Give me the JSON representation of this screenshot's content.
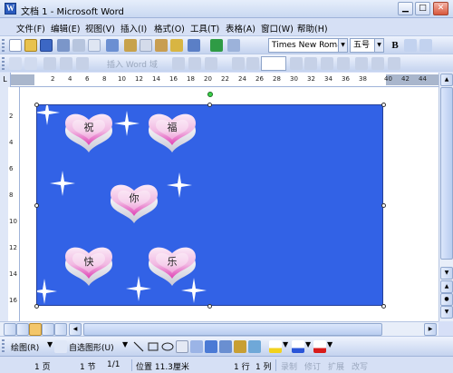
{
  "window": {
    "title": "文档 1 - Microsoft Word",
    "app_icon": "W",
    "min": "▁",
    "max": "□",
    "close": "✕"
  },
  "menu": [
    {
      "label": "文件(F)"
    },
    {
      "label": "编辑(E)"
    },
    {
      "label": "视图(V)"
    },
    {
      "label": "插入(I)"
    },
    {
      "label": "格式(O)"
    },
    {
      "label": "工具(T)"
    },
    {
      "label": "表格(A)"
    },
    {
      "label": "窗口(W)"
    },
    {
      "label": "帮助(H)"
    }
  ],
  "toolbar": {
    "font_name": "Times New Roman",
    "font_size": "五号",
    "bold": "B",
    "italic": "I"
  },
  "toolbar2": {
    "insert_word_field": "插入 Word 域"
  },
  "ruler": {
    "tab_symbol": "L",
    "h_numbers": [
      "2",
      "4",
      "6",
      "8",
      "10",
      "12",
      "14",
      "16",
      "18",
      "20",
      "22",
      "24",
      "26",
      "28",
      "30",
      "32",
      "34",
      "36",
      "38",
      "40",
      "42",
      "44"
    ],
    "v_numbers": [
      "2",
      "4",
      "6",
      "8",
      "10",
      "12",
      "14",
      "16"
    ]
  },
  "canvas": {
    "background": "#3262e6",
    "hearts": [
      {
        "label": "祝"
      },
      {
        "label": "福"
      },
      {
        "label": "你"
      },
      {
        "label": "快"
      },
      {
        "label": "乐"
      }
    ]
  },
  "drawing_toolbar": {
    "draw_label": "绘图(R)",
    "autoshapes_label": "自选图形(U)"
  },
  "status": {
    "page": "1 页",
    "section": "1 节",
    "page_of": "1/1",
    "position": "位置 11.3厘米",
    "line": "1 行",
    "column": "1 列",
    "rec": "录制",
    "trk": "修订",
    "ext": "扩展",
    "ovr": "改写"
  }
}
